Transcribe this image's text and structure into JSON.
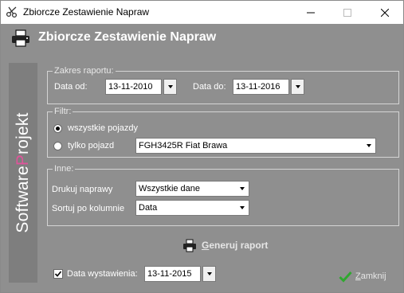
{
  "window": {
    "title": "Zbiorcze Zestawienie Napraw",
    "header_title": "Zbiorcze Zestawienie Napraw",
    "brand": {
      "part1": "Software",
      "part2": "P",
      "part3": "rojekt"
    }
  },
  "zakres": {
    "legend": "Zakres raportu:",
    "date_from_label": "Data od:",
    "date_from": "13-11-2010",
    "date_to_label": "Data do:",
    "date_to": "13-11-2016"
  },
  "filtr": {
    "legend": "Filtr:",
    "option_all": "wszystkie pojazdy",
    "option_one": "tylko pojazd",
    "vehicle": "FGH3425R Fiat Brawa",
    "selected": "all"
  },
  "inne": {
    "legend": "Inne:",
    "print_label": "Drukuj naprawy",
    "print_value": "Wszystkie dane",
    "sort_label": "Sortuj po kolumnie",
    "sort_value": "Data"
  },
  "generate": {
    "first": "G",
    "rest": "eneruj raport"
  },
  "issue_date": {
    "label": "Data wystawienia:",
    "value": "13-11-2015",
    "checked": true
  },
  "close": {
    "first": "Z",
    "rest": "amknij"
  },
  "colors": {
    "panel": "#8f8f8f",
    "sidebar": "#7e7e7e",
    "accent": "#e0539b",
    "check_green": "#2fa82f"
  },
  "icons": [
    "scissors-icon",
    "minimize-icon",
    "maximize-icon",
    "close-icon",
    "printer-icon",
    "checkmark-icon"
  ]
}
